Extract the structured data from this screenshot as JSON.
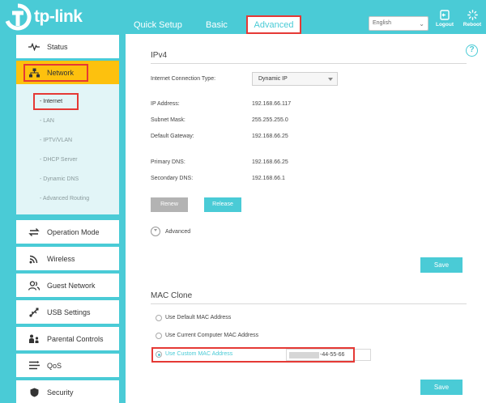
{
  "header": {
    "brand": "tp-link",
    "tabs": {
      "quick_setup": "Quick Setup",
      "basic": "Basic",
      "advanced": "Advanced"
    },
    "language": "English",
    "logout": "Logout",
    "reboot": "Reboot"
  },
  "sidebar": {
    "items": [
      {
        "label": "Status",
        "icon": "pulse-icon"
      },
      {
        "label": "Network",
        "icon": "network-icon"
      },
      {
        "label": "Operation Mode",
        "icon": "operation-mode-icon"
      },
      {
        "label": "Wireless",
        "icon": "wireless-icon"
      },
      {
        "label": "Guest Network",
        "icon": "guest-icon"
      },
      {
        "label": "USB Settings",
        "icon": "usb-icon"
      },
      {
        "label": "Parental Controls",
        "icon": "parental-icon"
      },
      {
        "label": "QoS",
        "icon": "qos-icon"
      },
      {
        "label": "Security",
        "icon": "shield-icon"
      }
    ],
    "network_sub": [
      "- Internet",
      "- LAN",
      "- IPTV/VLAN",
      "- DHCP Server",
      "- Dynamic DNS",
      "- Advanced Routing"
    ]
  },
  "ipv4": {
    "title": "IPv4",
    "conn_type_label": "Internet Connection Type:",
    "conn_type_value": "Dynamic IP",
    "ip_label": "IP Address:",
    "ip_value": "192.168.66.117",
    "mask_label": "Subnet Mask:",
    "mask_value": "255.255.255.0",
    "gateway_label": "Default Gateway:",
    "gateway_value": "192.168.66.25",
    "pdns_label": "Primary DNS:",
    "pdns_value": "192.168.66.25",
    "sdns_label": "Secondary DNS:",
    "sdns_value": "192.168.66.1",
    "renew": "Renew",
    "release": "Release",
    "advanced": "Advanced",
    "save": "Save"
  },
  "mac_clone": {
    "title": "MAC Clone",
    "opt_default": "Use Default MAC Address",
    "opt_current": "Use Current Computer MAC Address",
    "opt_custom": "Use Custom MAC Address",
    "custom_value_visible": "-44-55-66",
    "save": "Save"
  },
  "colors": {
    "accent": "#4acbd6",
    "active": "#fdc10e",
    "highlight": "#e53935"
  }
}
